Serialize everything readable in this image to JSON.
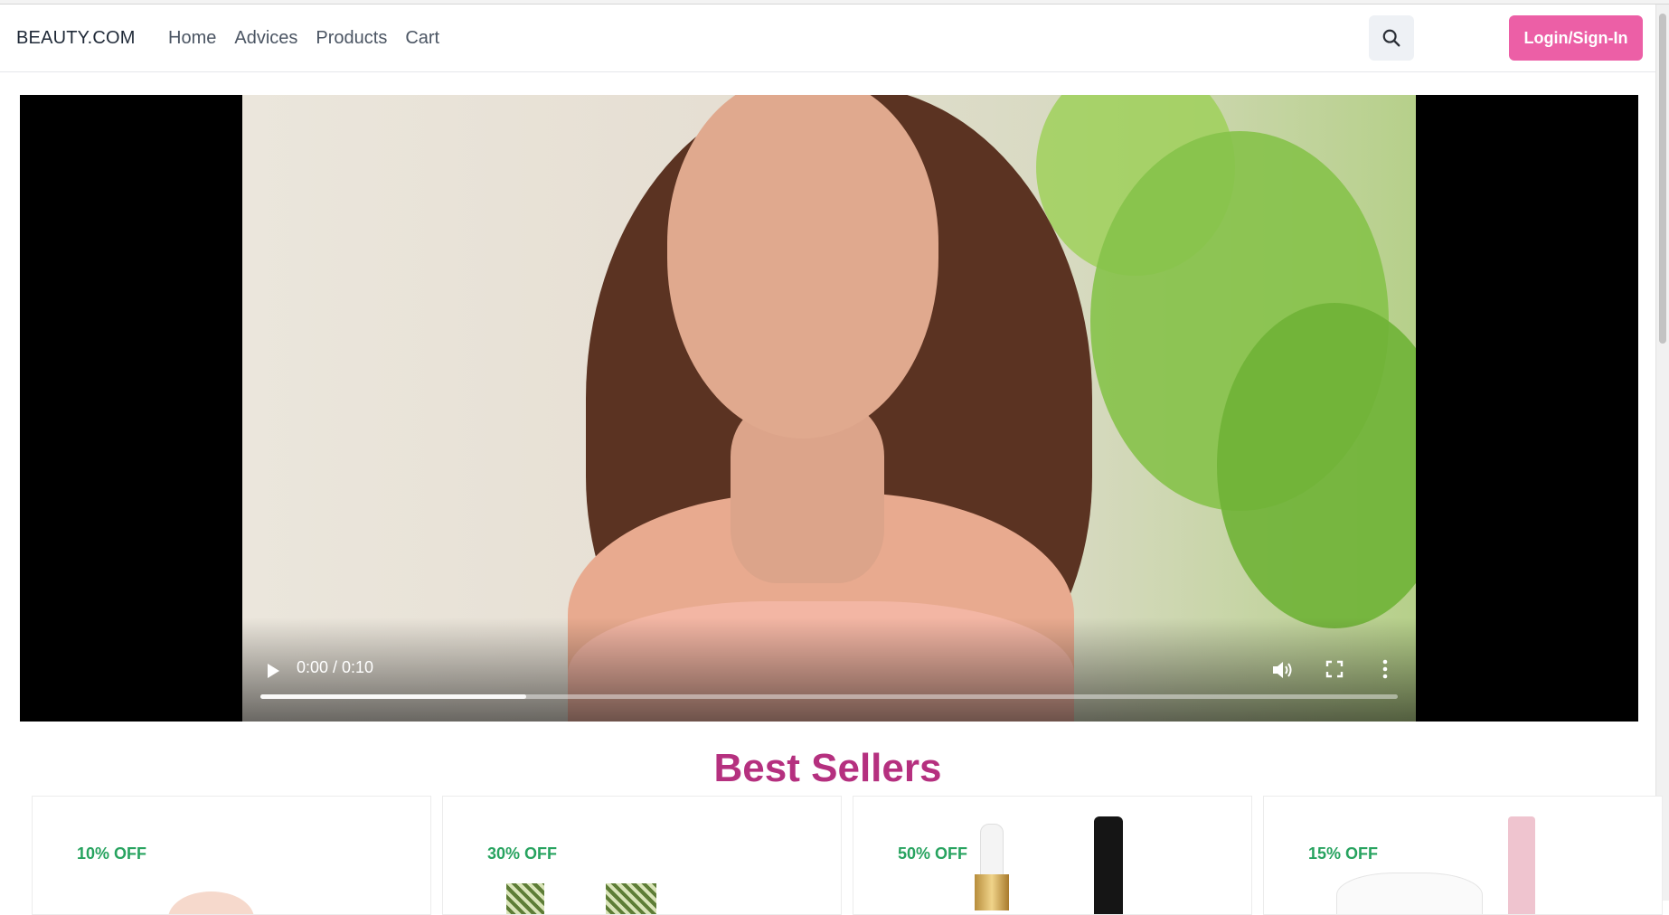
{
  "header": {
    "brand": "BEAUTY.COM",
    "nav": [
      "Home",
      "Advices",
      "Products",
      "Cart"
    ],
    "search_icon": "search-icon",
    "login_label": "Login/Sign-In"
  },
  "video": {
    "time": "0:00 / 0:10",
    "buffered_fraction": 0.234,
    "icons": [
      "play-icon",
      "volume-icon",
      "fullscreen-icon",
      "more-options-icon"
    ]
  },
  "best_sellers": {
    "title": "Best Sellers",
    "cards": [
      {
        "discount": "10% OFF"
      },
      {
        "discount": "30% OFF"
      },
      {
        "discount": "50% OFF"
      },
      {
        "discount": "15% OFF"
      }
    ]
  },
  "colors": {
    "accent": "#ec5fa6",
    "title": "#b5307f",
    "discount": "#27a35f"
  }
}
